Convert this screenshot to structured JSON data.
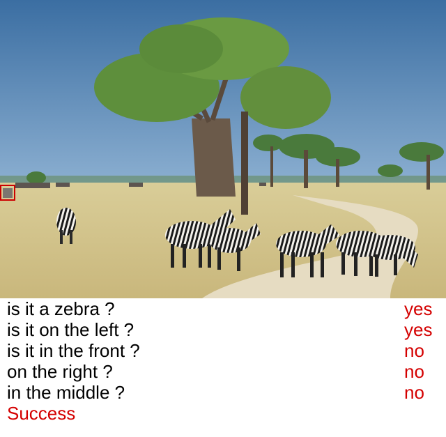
{
  "scene": {
    "description_icon": "zebra-savanna-photo",
    "highlight_color": "#cc0000"
  },
  "qa": [
    {
      "question": "is it a zebra ?",
      "answer": "yes"
    },
    {
      "question": "is it on the left ?",
      "answer": "yes"
    },
    {
      "question": "is it in the front ?",
      "answer": "no"
    },
    {
      "question": "on the right ?",
      "answer": "no"
    },
    {
      "question": "in the middle ?",
      "answer": "no"
    }
  ],
  "result": "Success",
  "colors": {
    "answer": "#d40000",
    "question": "#000000",
    "result": "#d40000",
    "sky_top": "#3d6fa3",
    "sky_bottom": "#7fa7cc",
    "grass": "#d8c88e"
  }
}
